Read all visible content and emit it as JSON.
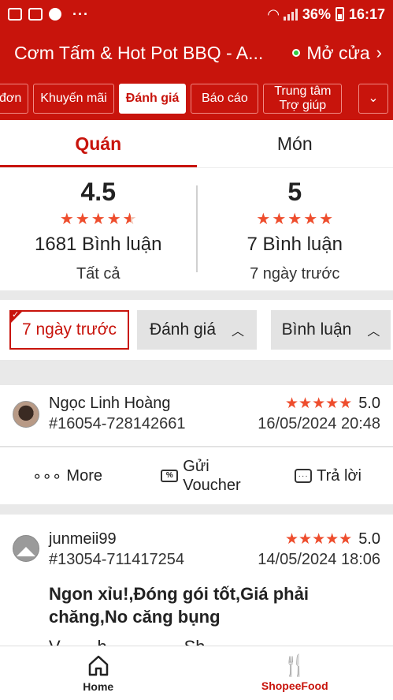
{
  "statusbar": {
    "dots": "···",
    "battery_pct": "36%",
    "time": "16:17"
  },
  "header": {
    "title": "Cơm Tấm & Hot Pot BBQ - A...",
    "open_status": "Mở cửa"
  },
  "nav_chips": [
    {
      "label": "đơn"
    },
    {
      "label": "Khuyến mãi"
    },
    {
      "label": "Đánh giá"
    },
    {
      "label": "Báo cáo"
    },
    {
      "label_line1": "Trung tâm",
      "label_line2": "Trợ giúp"
    }
  ],
  "review_tabs": {
    "store": "Quán",
    "dish": "Món"
  },
  "summary": {
    "store": {
      "score": "4.5",
      "count": "1681 Bình luận",
      "period": "Tất cả"
    },
    "dish": {
      "score": "5",
      "count": "7 Bình luận",
      "period": "7 ngày trước"
    }
  },
  "filters": {
    "period": "7 ngày trước",
    "rating": "Đánh giá",
    "comment": "Bình luận"
  },
  "reviews": [
    {
      "name": "Ngọc Linh Hoàng",
      "order_id": "#16054-728142661",
      "rating": "5.0",
      "date": "16/05/2024 20:48"
    },
    {
      "name": "junmeii99",
      "order_id": "#13054-711417254",
      "rating": "5.0",
      "date": "14/05/2024 18:06",
      "comment": "Ngon xỉu!,Đóng gói tốt,Giá phải chăng,No căng bụng",
      "comment_cut": "V... ... h... ... ... ... Sh"
    }
  ],
  "review_actions": {
    "more": "More",
    "voucher_line1": "Gửi",
    "voucher_line2": "Voucher",
    "reply": "Trả lời"
  },
  "bottom_nav": {
    "home": "Home",
    "food": "ShopeeFood"
  },
  "colors": {
    "brand": "#c8140c",
    "star": "#ee4d2d"
  }
}
